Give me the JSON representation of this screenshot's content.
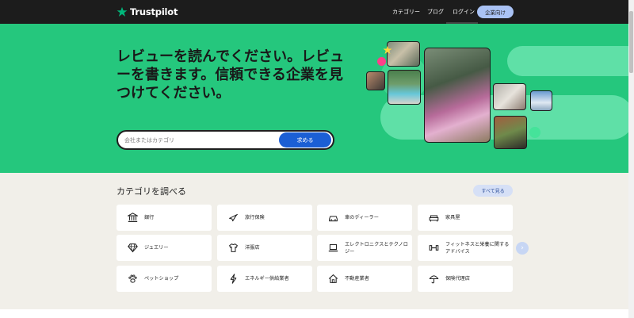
{
  "header": {
    "logo_text": "Trustpilot",
    "nav": {
      "categories": "カテゴリー",
      "blog": "ブログ",
      "login": "ログイン",
      "business": "企業向け"
    }
  },
  "hero": {
    "title": "レビューを読んでください。レビューを書きます。信頼できる企業を見つけてください。",
    "search_placeholder": "会社またはカテゴリ",
    "search_button": "求める"
  },
  "categories": {
    "title": "カテゴリを調べる",
    "see_all": "すべて見る",
    "items": [
      {
        "label": "銀行",
        "icon": "bank-icon"
      },
      {
        "label": "旅行保険",
        "icon": "airplane-icon"
      },
      {
        "label": "車のディーラー",
        "icon": "car-icon"
      },
      {
        "label": "家具屋",
        "icon": "sofa-icon"
      },
      {
        "label": "ジュエリー",
        "icon": "diamond-icon"
      },
      {
        "label": "洋服店",
        "icon": "shirt-icon"
      },
      {
        "label": "エレクトロニクスとテクノロジー",
        "icon": "laptop-icon"
      },
      {
        "label": "フィットネスと栄養に関するアドバイス",
        "icon": "dumbbell-icon"
      },
      {
        "label": "ペットショップ",
        "icon": "paw-icon"
      },
      {
        "label": "エネルギー供給業者",
        "icon": "lightning-icon"
      },
      {
        "label": "不動産業者",
        "icon": "house-icon"
      },
      {
        "label": "保険代理店",
        "icon": "umbrella-icon"
      }
    ]
  },
  "colors": {
    "hero_bg": "#25c77d",
    "header_bg": "#1c1c1c",
    "search_button": "#1b5fd4",
    "section_bg": "#f1efe9"
  }
}
